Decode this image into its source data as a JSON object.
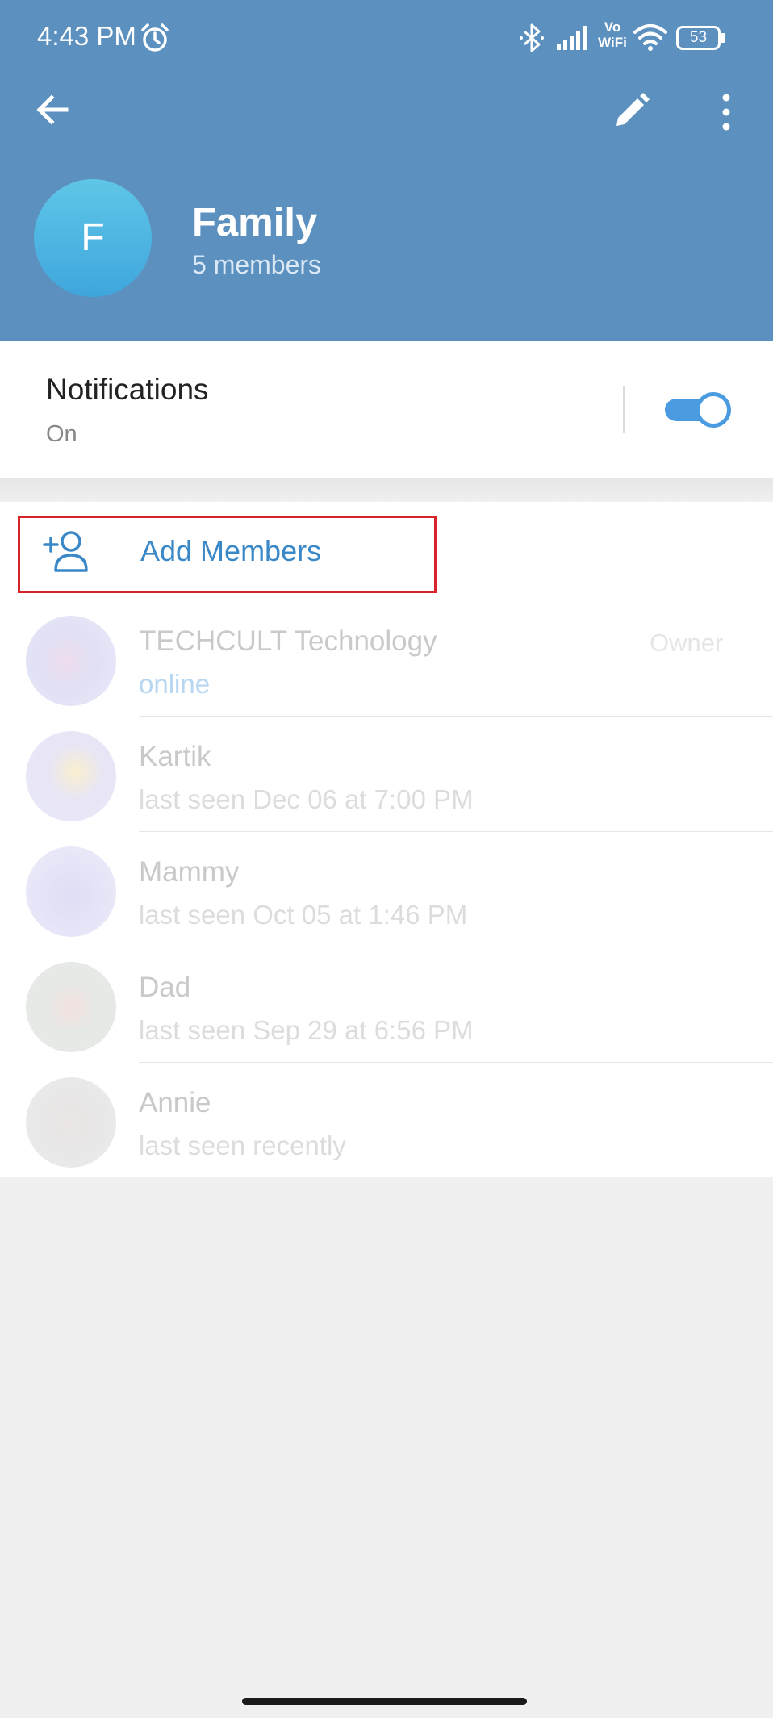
{
  "status_bar": {
    "time": "4:43 PM",
    "vowifi_top": "Vo",
    "vowifi_bottom": "WiFi",
    "battery": "53"
  },
  "header": {
    "avatar_letter": "F",
    "group_name": "Family",
    "members_count": "5 members"
  },
  "notifications": {
    "title": "Notifications",
    "value": "On",
    "toggle_on": true
  },
  "add_members": {
    "label": "Add Members"
  },
  "members": [
    {
      "name": "TECHCULT Technology",
      "status": "online",
      "role": "Owner"
    },
    {
      "name": "Kartik",
      "status": "last seen Dec 06 at 7:00 PM",
      "role": ""
    },
    {
      "name": "Mammy",
      "status": "last seen Oct 05 at 1:46 PM",
      "role": ""
    },
    {
      "name": "Dad",
      "status": "last seen Sep 29 at 6:56 PM",
      "role": ""
    },
    {
      "name": "Annie",
      "status": "last seen recently",
      "role": ""
    }
  ],
  "colors": {
    "header": "#5b90bf",
    "accent": "#4a9be0",
    "highlight_box": "#d8232a"
  }
}
